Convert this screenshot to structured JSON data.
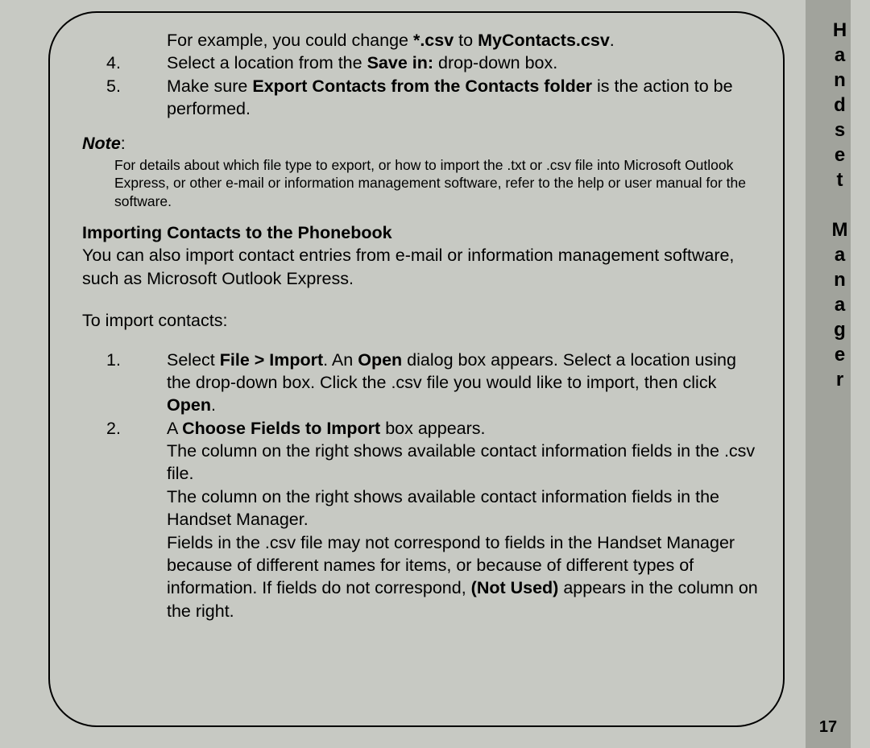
{
  "sidebar": {
    "title": "Handset Manager",
    "page_number": "17"
  },
  "top_list": {
    "indent_text_pre": "For example, you could change ",
    "indent_bold_a": "*.csv",
    "indent_mid": " to ",
    "indent_bold_b": "MyContacts.csv",
    "indent_text_post": ".",
    "item4_num": "4.",
    "item4_pre": "Select a location from the ",
    "item4_bold": "Save in:",
    "item4_post": "  drop-down box.",
    "item5_num": "5.",
    "item5_pre": "Make sure ",
    "item5_bold": "Export Contacts from the Contacts folder",
    "item5_post": " is the action to be performed."
  },
  "note": {
    "label": "Note",
    "colon": ":",
    "body": "For details about which file type to export, or how to import the .txt or .csv file into Microsoft Outlook Express, or other e-mail or information management software, refer to the help or user manual for the software."
  },
  "section": {
    "title": "Importing Contacts to the Phonebook",
    "intro": "You can also import contact entries from e-mail or information management software, such as Microsoft Outlook Express.",
    "lead": "To import contacts:"
  },
  "import_list": {
    "item1_num": "1.",
    "item1_a": "Select ",
    "item1_b_bold": "File > Import",
    "item1_c": ". An ",
    "item1_d_bold": "Open",
    "item1_e": " dialog box appears. Select a location using the drop-down box. Click the .csv file you would like to import, then click ",
    "item1_f_bold": "Open",
    "item1_g": ".",
    "item2_num": "2.",
    "item2_line1_a": "A ",
    "item2_line1_b_bold": "Choose Fields to Import",
    "item2_line1_c": " box appears.",
    "item2_line2": "The column on the right shows available contact information fields in the .csv file.",
    "item2_line3": "The column on the right shows available contact information fields in the Handset Manager.",
    "item2_line4_a": "Fields in the .csv file may not correspond to fields in the Handset Manager because of different names for items, or because of different types of information. If fields do not correspond, ",
    "item2_line4_b_bold": "(Not Used)",
    "item2_line4_c": " appears in the column on the right."
  }
}
